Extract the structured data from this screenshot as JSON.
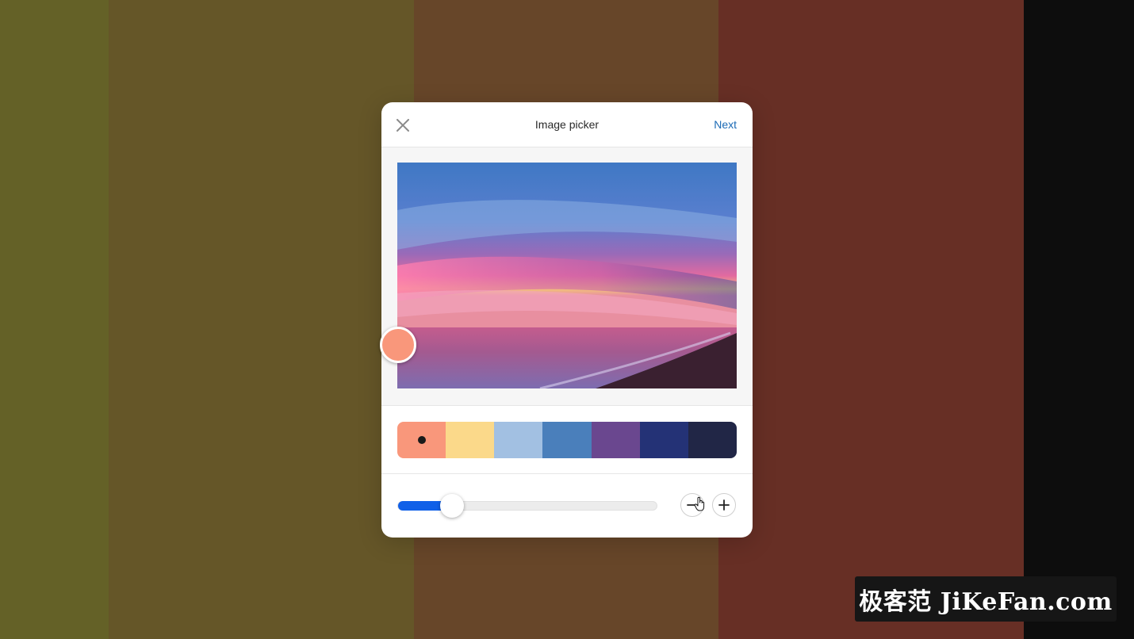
{
  "background": {
    "colors": [
      "#646127",
      "#655628",
      "#674629",
      "#672f25",
      "#0d0d0d"
    ]
  },
  "dialog": {
    "title": "Image picker",
    "close_icon": "close-icon",
    "next_label": "Next"
  },
  "image": {
    "subject": "sunset-over-sea-photo",
    "picker_color": "#f9977b"
  },
  "palette": {
    "selected_index": 0,
    "swatches": [
      "#f9977b",
      "#fbd98a",
      "#a2c0e2",
      "#4a7fbb",
      "#6a478f",
      "#243276",
      "#212646"
    ]
  },
  "zoom": {
    "value_percent": 21,
    "minus_icon": "minus-icon",
    "plus_icon": "plus-icon",
    "accent": "#1060e8"
  },
  "watermark": {
    "text": "极客范 JiKeFan.com"
  }
}
